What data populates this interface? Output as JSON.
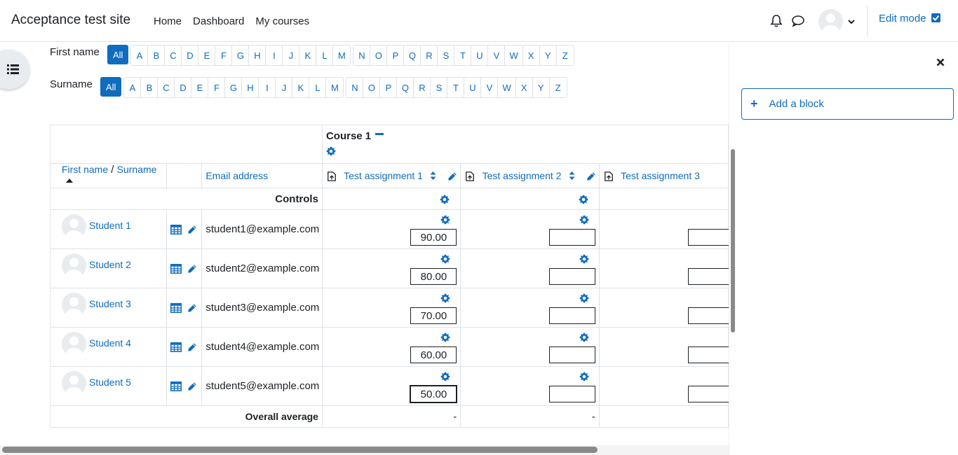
{
  "header": {
    "site_name": "Acceptance test site",
    "nav": [
      "Home",
      "Dashboard",
      "My courses"
    ],
    "edit_mode_label": "Edit mode",
    "edit_mode_checked": true
  },
  "initials": {
    "firstname_label": "First name",
    "surname_label": "Surname",
    "all_label": "All",
    "letters_a_m": [
      "A",
      "B",
      "C",
      "D",
      "E",
      "F",
      "G",
      "H",
      "I",
      "J",
      "K",
      "L",
      "M"
    ],
    "letters_n_z": [
      "N",
      "O",
      "P",
      "Q",
      "R",
      "S",
      "T",
      "U",
      "V",
      "W",
      "X",
      "Y",
      "Z"
    ]
  },
  "grader": {
    "course_name": "Course 1",
    "col_firstname": "First name",
    "col_sep": " / ",
    "col_surname": "Surname",
    "col_email": "Email address",
    "assignments": [
      "Test assignment 1",
      "Test assignment 2",
      "Test assignment 3"
    ],
    "controls_label": "Controls",
    "students": [
      {
        "name": "Student 1",
        "email": "student1@example.com",
        "grade1": "90.00",
        "grade2": ""
      },
      {
        "name": "Student 2",
        "email": "student2@example.com",
        "grade1": "80.00",
        "grade2": ""
      },
      {
        "name": "Student 3",
        "email": "student3@example.com",
        "grade1": "70.00",
        "grade2": ""
      },
      {
        "name": "Student 4",
        "email": "student4@example.com",
        "grade1": "60.00",
        "grade2": ""
      },
      {
        "name": "Student 5",
        "email": "student5@example.com",
        "grade1": "50.00",
        "grade2": ""
      }
    ],
    "overall_average_label": "Overall average",
    "avg1": "-",
    "avg2": "-"
  },
  "drawer": {
    "add_block_label": "Add a block"
  },
  "help_label": "?",
  "colors": {
    "link": "#0f6cbf",
    "border": "#dee2e6",
    "text": "#1d2125"
  }
}
